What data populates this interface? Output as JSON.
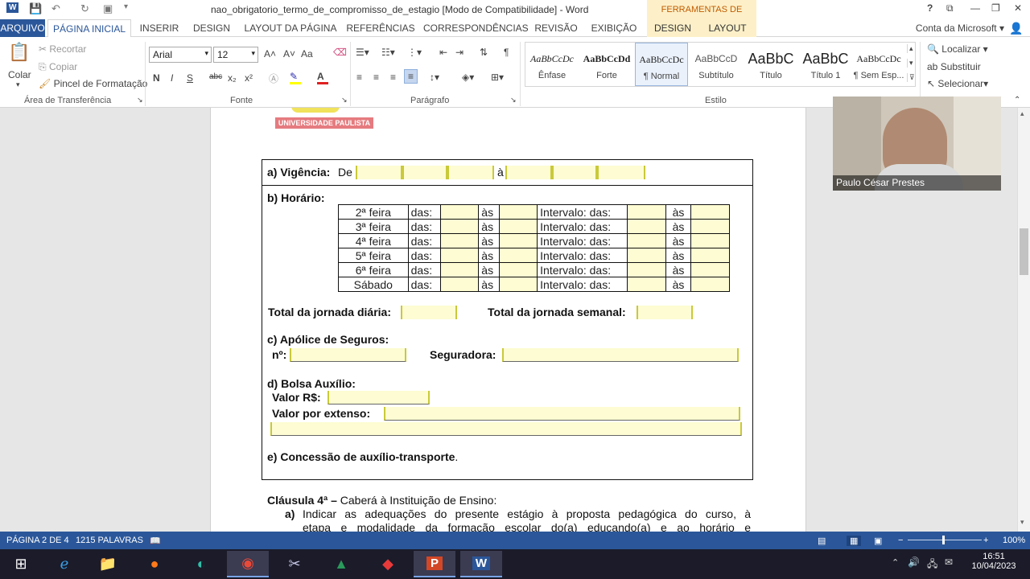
{
  "window": {
    "title": "nao_obrigatorio_termo_de_compromisso_de_estagio [Modo de Compatibilidade] - Word",
    "context_tools": "FERRAMENTAS DE TABELA",
    "help": "?"
  },
  "tabs": [
    "ARQUIVO",
    "PÁGINA INICIAL",
    "INSERIR",
    "DESIGN",
    "LAYOUT DA PÁGINA",
    "REFERÊNCIAS",
    "CORRESPONDÊNCIAS",
    "REVISÃO",
    "EXIBIÇÃO",
    "DESIGN",
    "LAYOUT"
  ],
  "account": "Conta da Microsoft",
  "ribbon": {
    "clipboard": {
      "paste": "Colar",
      "cut": "Recortar",
      "copy": "Copiar",
      "format_painter": "Pincel de Formatação",
      "label": "Área de Transferência"
    },
    "font": {
      "name": "Arial",
      "size": "12",
      "label": "Fonte",
      "bold": "N",
      "italic": "I",
      "underline": "S",
      "strike": "abc",
      "sub": "x₂",
      "sup": "x²",
      "grow": "A˄",
      "shrink": "A˅",
      "case": "Aa",
      "color_a": "A"
    },
    "paragraph": {
      "label": "Parágrafo",
      "pilcrow": "¶"
    },
    "styles": {
      "label": "Estilo",
      "items": [
        {
          "preview": "AaBbCcDc",
          "name": "Ênfase"
        },
        {
          "preview": "AaBbCcDd",
          "name": "Forte"
        },
        {
          "preview": "AaBbCcDc",
          "name": "¶ Normal"
        },
        {
          "preview": "AaBbCcD",
          "name": "Subtítulo"
        },
        {
          "preview": "AaBbC",
          "name": "Título"
        },
        {
          "preview": "AaBbC",
          "name": "Título 1"
        },
        {
          "preview": "AaBbCcDc",
          "name": "¶ Sem Esp..."
        }
      ]
    },
    "editing": {
      "find": "Localizar",
      "replace": "Substituir",
      "select": "Selecionar"
    }
  },
  "document": {
    "logo_text": "UNIVERSIDADE PAULISTA",
    "vigencia_label": "a) Vigência:",
    "vigencia_de": "De",
    "vigencia_a": "à",
    "horario_label": "b) Horário:",
    "schedule": [
      {
        "day": "2ª feira",
        "das": "das:",
        "as": "às",
        "intervalo": "Intervalo: das:",
        "as2": "às"
      },
      {
        "day": "3ª feira",
        "das": "das:",
        "as": "às",
        "intervalo": "Intervalo: das:",
        "as2": "às"
      },
      {
        "day": "4ª feira",
        "das": "das:",
        "as": "às",
        "intervalo": "Intervalo: das:",
        "as2": "às"
      },
      {
        "day": "5ª feira",
        "das": "das:",
        "as": "às",
        "intervalo": "Intervalo: das:",
        "as2": "às"
      },
      {
        "day": "6ª feira",
        "das": "das:",
        "as": "às",
        "intervalo": "Intervalo: das:",
        "as2": "às"
      },
      {
        "day": "Sábado",
        "das": "das:",
        "as": "às",
        "intervalo": "Intervalo: das:",
        "as2": "às"
      }
    ],
    "total_diaria": "Total da jornada diária:",
    "total_semanal": "Total da jornada semanal:",
    "apolice_label": "c) Apólice de Seguros:",
    "apolice_num": "nº:",
    "seguradora": "Seguradora:",
    "bolsa_label": "d) Bolsa Auxílio:",
    "valor": "Valor R$:",
    "valor_extenso": "Valor por extenso:",
    "transporte": "e) Concessão de auxílio-transporte",
    "transporte_end": ".",
    "clausula_title": "Cláusula 4ª –",
    "clausula_text": "Caberá à Instituição de Ensino:",
    "item_a": "a)",
    "item_a_line1": "Indicar as adequações do presente estágio à proposta pedagógica do curso, à",
    "item_a_line2": "etapa e modalidade da formação escolar do(a) educando(a) e ao horário e"
  },
  "status": {
    "page": "PÁGINA 2 DE 4",
    "words": "1215 PALAVRAS",
    "zoom": "100%"
  },
  "webcam": {
    "name": "Paulo César Prestes"
  },
  "clock": {
    "time": "16:51",
    "date": "10/04/2023"
  }
}
